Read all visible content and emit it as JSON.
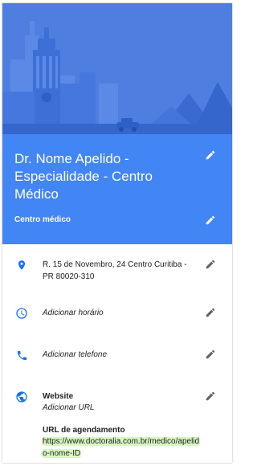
{
  "header": {
    "title": "Dr. Nome Apelido - Especialidade - Centro Médico",
    "category": "Centro médico"
  },
  "rows": {
    "address": "R. 15 de Novembro, 24 Centro Curitiba - PR 80020-310",
    "hours": "Adicionar horário",
    "phone": "Adicionar telefone",
    "website_label": "Website",
    "website_value": "Adicionar URL",
    "booking_label": "URL de agendamento",
    "booking_url": "https://www.doctoralia.com.br/medico/apelido-nome-ID"
  },
  "icons": {
    "edit": "pencil-icon",
    "address": "location-pin-icon",
    "hours": "clock-icon",
    "phone": "phone-icon",
    "website": "globe-icon"
  },
  "colors": {
    "primary": "#4285f4",
    "hero_bg": "#4d80e4",
    "icon_blue": "#1a73e8",
    "highlight": "#d8f7c1"
  }
}
